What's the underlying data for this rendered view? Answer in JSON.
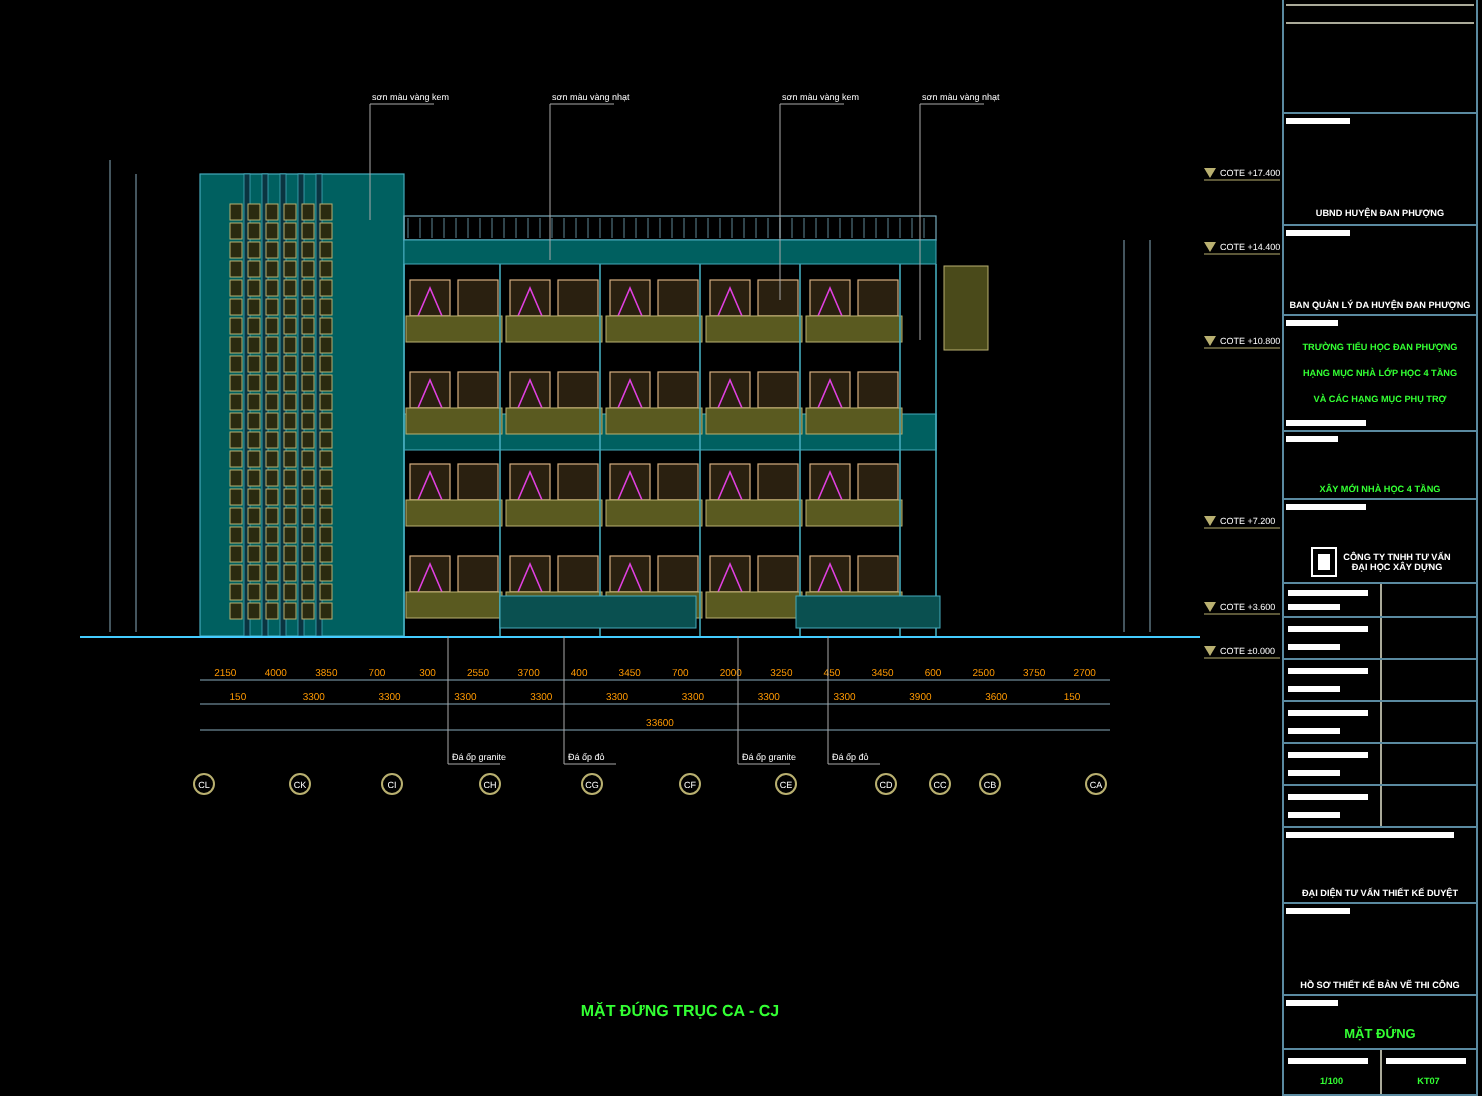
{
  "drawing": {
    "title": "MẶT ĐỨNG TRỤC CA - CJ",
    "leader_notes": [
      "sơn màu vàng kem",
      "sơn màu vàng nhạt",
      "sơn màu vàng kem",
      "sơn màu vàng nhạt"
    ],
    "levels": [
      "COTE +17.400",
      "COTE +14.400",
      "COTE +10.800",
      "COTE +7.200",
      "COTE +3.600",
      "COTE ±0.000"
    ],
    "dims_row_1": [
      "2150",
      "4000",
      "3850",
      "700",
      "300",
      "2550",
      "3700",
      "400",
      "3450",
      "700",
      "2000",
      "3250",
      "450",
      "3450",
      "600",
      "2500",
      "3750",
      "2700"
    ],
    "dims_row_2": [
      "150",
      "3300",
      "3300",
      "3300",
      "3300",
      "3300",
      "3300",
      "3300",
      "3300",
      "3900",
      "3600",
      "150"
    ],
    "overall_dim": "33600",
    "bottom_notes": [
      "Đá ốp granite",
      "Đá ốp đỏ",
      "Đá ốp granite",
      "Đá ốp đỏ"
    ],
    "axes": [
      "CL",
      "CK",
      "CI",
      "CH",
      "CG",
      "CF",
      "CE",
      "CD",
      "CC",
      "CB",
      "CA"
    ]
  },
  "title_block": {
    "owner": "UBND HUYỆN ĐAN PHƯỢNG",
    "client": "BAN QUẢN LÝ DA HUYỆN ĐAN PHƯỢNG",
    "project": [
      "TRƯỜNG TIỂU HỌC ĐAN PHƯỢNG",
      "HẠNG MỤC NHÀ LỚP HỌC 4 TẦNG",
      "VÀ CÁC HẠNG MỤC PHỤ TRỢ"
    ],
    "work": "XÂY MỚI NHÀ HỌC 4 TẦNG",
    "company": [
      "CÔNG TY TNHH TƯ VẤN",
      "ĐẠI HỌC XÂY DỰNG"
    ],
    "approval": "ĐẠI DIỆN TƯ VẤN THIẾT KẾ DUYỆT",
    "stage": "HỒ SƠ THIẾT KẾ BẢN VẼ THI CÔNG",
    "sheet_title": "MẶT ĐỨNG",
    "scale": "1/100",
    "sheet_no": "KT07"
  }
}
